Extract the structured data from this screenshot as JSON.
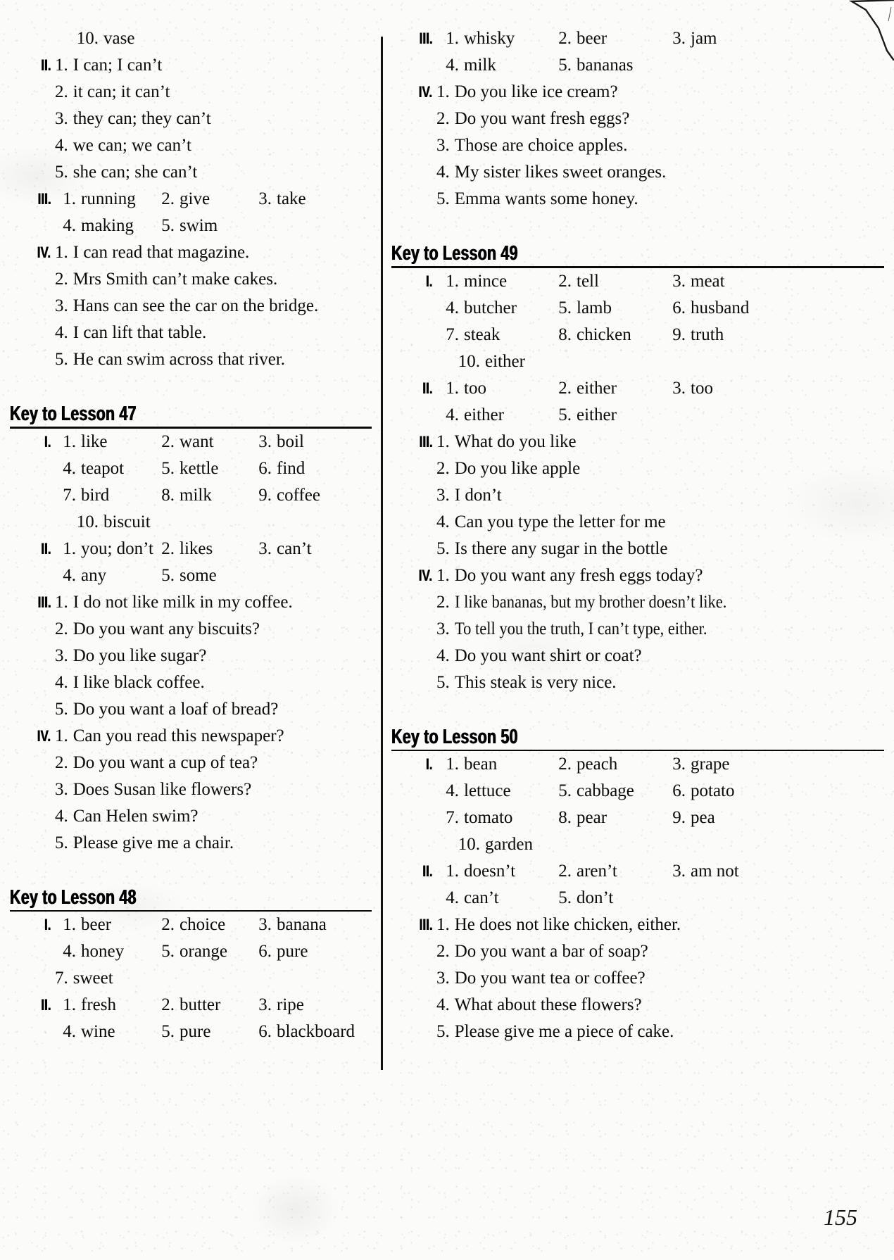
{
  "page": {
    "number": "155",
    "divider": true
  },
  "left_column": {
    "continued_block": {
      "rows": [
        {
          "marker": "",
          "items": [
            {
              "num": "10.",
              "text": "vase"
            }
          ]
        },
        {
          "marker": "II.",
          "items": [
            {
              "num": "1.",
              "text": "I can; I can’t"
            }
          ]
        },
        {
          "marker": "",
          "items": [
            {
              "num": "2.",
              "text": "it can; it can’t"
            }
          ]
        },
        {
          "marker": "",
          "items": [
            {
              "num": "3.",
              "text": "they can; they can’t"
            }
          ]
        },
        {
          "marker": "",
          "items": [
            {
              "num": "4.",
              "text": "we can; we can’t"
            }
          ]
        },
        {
          "marker": "",
          "items": [
            {
              "num": "5.",
              "text": "she can; she can’t"
            }
          ]
        },
        {
          "marker": "III.",
          "items": [
            {
              "num": "1.",
              "text": "running"
            },
            {
              "num": "2.",
              "text": "give"
            },
            {
              "num": "3.",
              "text": "take"
            }
          ]
        },
        {
          "marker": "",
          "items": [
            {
              "num": "4.",
              "text": "making"
            },
            {
              "num": "5.",
              "text": "swim"
            }
          ]
        },
        {
          "marker": "IV.",
          "items": [
            {
              "num": "1.",
              "text": "I can read that magazine."
            }
          ]
        },
        {
          "marker": "",
          "items": [
            {
              "num": "2.",
              "text": "Mrs Smith can’t make cakes."
            }
          ]
        },
        {
          "marker": "",
          "items": [
            {
              "num": "3.",
              "text": "Hans can see the car on the bridge."
            }
          ]
        },
        {
          "marker": "",
          "items": [
            {
              "num": "4.",
              "text": "I can lift that table."
            }
          ]
        },
        {
          "marker": "",
          "items": [
            {
              "num": "5.",
              "text": "He can swim across that river."
            }
          ]
        }
      ]
    },
    "lessons": [
      {
        "title": "Key to Lesson 47",
        "rows": [
          {
            "marker": "I.",
            "items": [
              {
                "num": "1.",
                "text": "like"
              },
              {
                "num": "2.",
                "text": "want"
              },
              {
                "num": "3.",
                "text": "boil"
              }
            ]
          },
          {
            "marker": "",
            "items": [
              {
                "num": "4.",
                "text": "teapot"
              },
              {
                "num": "5.",
                "text": "kettle"
              },
              {
                "num": "6.",
                "text": "find"
              }
            ]
          },
          {
            "marker": "",
            "items": [
              {
                "num": "7.",
                "text": "bird"
              },
              {
                "num": "8.",
                "text": "milk"
              },
              {
                "num": "9.",
                "text": "coffee"
              }
            ]
          },
          {
            "marker": "",
            "items": [
              {
                "num": "10.",
                "text": "biscuit"
              }
            ]
          },
          {
            "marker": "II.",
            "items": [
              {
                "num": "1.",
                "text": "you; don’t"
              },
              {
                "num": "2.",
                "text": "likes"
              },
              {
                "num": "3.",
                "text": "can’t"
              }
            ]
          },
          {
            "marker": "",
            "items": [
              {
                "num": "4.",
                "text": "any"
              },
              {
                "num": "5.",
                "text": "some"
              }
            ]
          },
          {
            "marker": "III.",
            "items": [
              {
                "num": "1.",
                "text": "I do not like milk in my coffee."
              }
            ]
          },
          {
            "marker": "",
            "items": [
              {
                "num": "2.",
                "text": "Do you want any biscuits?"
              }
            ]
          },
          {
            "marker": "",
            "items": [
              {
                "num": "3.",
                "text": "Do you like sugar?"
              }
            ]
          },
          {
            "marker": "",
            "items": [
              {
                "num": "4.",
                "text": "I like black coffee."
              }
            ]
          },
          {
            "marker": "",
            "items": [
              {
                "num": "5.",
                "text": "Do you want a loaf of bread?"
              }
            ]
          },
          {
            "marker": "IV.",
            "items": [
              {
                "num": "1.",
                "text": "Can you read this newspaper?"
              }
            ]
          },
          {
            "marker": "",
            "items": [
              {
                "num": "2.",
                "text": "Do you want a cup of tea?"
              }
            ]
          },
          {
            "marker": "",
            "items": [
              {
                "num": "3.",
                "text": "Does Susan like flowers?"
              }
            ]
          },
          {
            "marker": "",
            "items": [
              {
                "num": "4.",
                "text": "Can Helen swim?"
              }
            ]
          },
          {
            "marker": "",
            "items": [
              {
                "num": "5.",
                "text": "Please give me a chair."
              }
            ]
          }
        ]
      },
      {
        "title": "Key to Lesson 48",
        "rows": [
          {
            "marker": "I.",
            "items": [
              {
                "num": "1.",
                "text": "beer"
              },
              {
                "num": "2.",
                "text": "choice"
              },
              {
                "num": "3.",
                "text": "banana"
              }
            ]
          },
          {
            "marker": "",
            "items": [
              {
                "num": "4.",
                "text": "honey"
              },
              {
                "num": "5.",
                "text": "orange"
              },
              {
                "num": "6.",
                "text": "pure"
              }
            ]
          },
          {
            "marker": "",
            "items": [
              {
                "num": "7.",
                "text": "sweet"
              }
            ]
          },
          {
            "marker": "II.",
            "items": [
              {
                "num": "1.",
                "text": "fresh"
              },
              {
                "num": "2.",
                "text": "butter"
              },
              {
                "num": "3.",
                "text": "ripe"
              }
            ]
          },
          {
            "marker": "",
            "items": [
              {
                "num": "4.",
                "text": "wine"
              },
              {
                "num": "5.",
                "text": "pure"
              },
              {
                "num": "6.",
                "text": "blackboard"
              }
            ]
          }
        ]
      }
    ]
  },
  "right_column": {
    "continued_block": {
      "rows": [
        {
          "marker": "III.",
          "items": [
            {
              "num": "1.",
              "text": "whisky"
            },
            {
              "num": "2.",
              "text": "beer"
            },
            {
              "num": "3.",
              "text": "jam"
            }
          ]
        },
        {
          "marker": "",
          "items": [
            {
              "num": "4.",
              "text": "milk"
            },
            {
              "num": "5.",
              "text": "bananas"
            }
          ]
        },
        {
          "marker": "IV.",
          "items": [
            {
              "num": "1.",
              "text": "Do you like ice cream?"
            }
          ]
        },
        {
          "marker": "",
          "items": [
            {
              "num": "2.",
              "text": "Do you want fresh eggs?"
            }
          ]
        },
        {
          "marker": "",
          "items": [
            {
              "num": "3.",
              "text": "Those are choice apples."
            }
          ]
        },
        {
          "marker": "",
          "items": [
            {
              "num": "4.",
              "text": "My sister likes sweet oranges."
            }
          ]
        },
        {
          "marker": "",
          "items": [
            {
              "num": "5.",
              "text": "Emma wants some honey."
            }
          ]
        }
      ]
    },
    "lessons": [
      {
        "title": "Key to Lesson 49",
        "rows": [
          {
            "marker": "I.",
            "items": [
              {
                "num": "1.",
                "text": "mince"
              },
              {
                "num": "2.",
                "text": "tell"
              },
              {
                "num": "3.",
                "text": "meat"
              }
            ]
          },
          {
            "marker": "",
            "items": [
              {
                "num": "4.",
                "text": "butcher"
              },
              {
                "num": "5.",
                "text": "lamb"
              },
              {
                "num": "6.",
                "text": "husband"
              }
            ]
          },
          {
            "marker": "",
            "items": [
              {
                "num": "7.",
                "text": "steak"
              },
              {
                "num": "8.",
                "text": "chicken"
              },
              {
                "num": "9.",
                "text": "truth"
              }
            ]
          },
          {
            "marker": "",
            "items": [
              {
                "num": "10.",
                "text": "either"
              }
            ]
          },
          {
            "marker": "II.",
            "items": [
              {
                "num": "1.",
                "text": "too"
              },
              {
                "num": "2.",
                "text": "either"
              },
              {
                "num": "3.",
                "text": "too"
              }
            ]
          },
          {
            "marker": "",
            "items": [
              {
                "num": "4.",
                "text": "either"
              },
              {
                "num": "5.",
                "text": "either"
              }
            ]
          },
          {
            "marker": "III.",
            "items": [
              {
                "num": "1.",
                "text": "What do you like"
              }
            ]
          },
          {
            "marker": "",
            "items": [
              {
                "num": "2.",
                "text": "Do you like apple"
              }
            ]
          },
          {
            "marker": "",
            "items": [
              {
                "num": "3.",
                "text": "I don’t"
              }
            ]
          },
          {
            "marker": "",
            "items": [
              {
                "num": "4.",
                "text": "Can you type the letter for me"
              }
            ]
          },
          {
            "marker": "",
            "items": [
              {
                "num": "5.",
                "text": "Is there any sugar in the bottle"
              }
            ]
          },
          {
            "marker": "IV.",
            "items": [
              {
                "num": "1.",
                "text": "Do you want any fresh eggs today?"
              }
            ]
          },
          {
            "marker": "",
            "condensed": true,
            "items": [
              {
                "num": "2.",
                "text": "I like bananas, but my brother doesn’t like."
              }
            ]
          },
          {
            "marker": "",
            "condensed": true,
            "items": [
              {
                "num": "3.",
                "text": "To tell you the truth, I can’t type, either."
              }
            ]
          },
          {
            "marker": "",
            "items": [
              {
                "num": "4.",
                "text": "Do you want shirt or coat?"
              }
            ]
          },
          {
            "marker": "",
            "items": [
              {
                "num": "5.",
                "text": "This steak is very nice."
              }
            ]
          }
        ]
      },
      {
        "title": "Key to Lesson 50",
        "rows": [
          {
            "marker": "I.",
            "items": [
              {
                "num": "1.",
                "text": "bean"
              },
              {
                "num": "2.",
                "text": "peach"
              },
              {
                "num": "3.",
                "text": "grape"
              }
            ]
          },
          {
            "marker": "",
            "items": [
              {
                "num": "4.",
                "text": "lettuce"
              },
              {
                "num": "5.",
                "text": "cabbage"
              },
              {
                "num": "6.",
                "text": "potato"
              }
            ]
          },
          {
            "marker": "",
            "items": [
              {
                "num": "7.",
                "text": "tomato"
              },
              {
                "num": "8.",
                "text": "pear"
              },
              {
                "num": "9.",
                "text": "pea"
              }
            ]
          },
          {
            "marker": "",
            "items": [
              {
                "num": "10.",
                "text": "garden"
              }
            ]
          },
          {
            "marker": "II.",
            "items": [
              {
                "num": "1.",
                "text": "doesn’t"
              },
              {
                "num": "2.",
                "text": "aren’t"
              },
              {
                "num": "3.",
                "text": "am not"
              }
            ]
          },
          {
            "marker": "",
            "items": [
              {
                "num": "4.",
                "text": "can’t"
              },
              {
                "num": "5.",
                "text": "don’t"
              }
            ]
          },
          {
            "marker": "III.",
            "items": [
              {
                "num": "1.",
                "text": "He does not like chicken, either."
              }
            ]
          },
          {
            "marker": "",
            "items": [
              {
                "num": "2.",
                "text": "Do you want a bar of soap?"
              }
            ]
          },
          {
            "marker": "",
            "items": [
              {
                "num": "3.",
                "text": "Do you want tea or coffee?"
              }
            ]
          },
          {
            "marker": "",
            "items": [
              {
                "num": "4.",
                "text": "What about these flowers?"
              }
            ]
          },
          {
            "marker": "",
            "items": [
              {
                "num": "5.",
                "text": "Please give me a piece of cake."
              }
            ]
          }
        ]
      }
    ]
  }
}
